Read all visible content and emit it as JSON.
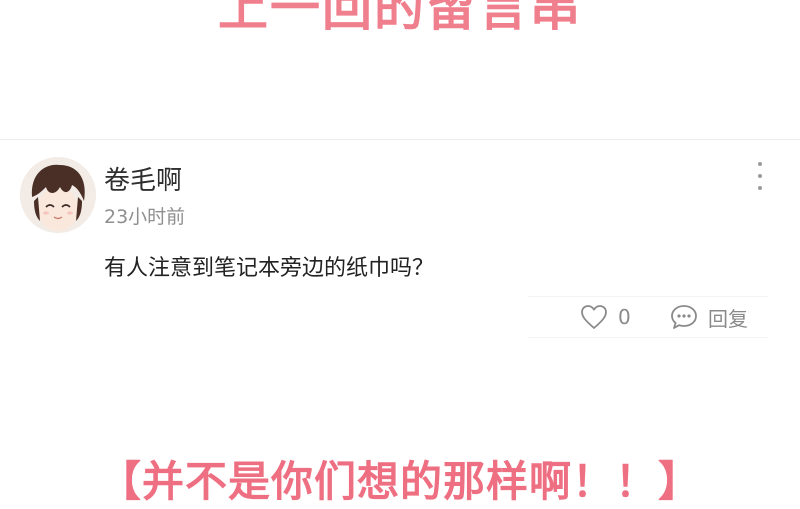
{
  "banner": {
    "text": "上一回的留言串"
  },
  "comment": {
    "username": "卷毛啊",
    "timestamp": "23小时前",
    "text": "有人注意到笔记本旁边的纸巾吗？",
    "likes": "0",
    "reply_label": "回复",
    "icons": {
      "more": "more-vertical-icon",
      "like": "heart-icon",
      "reply": "chat-bubble-icon"
    }
  },
  "caption": {
    "text": "【并不是你们想的那样啊！！】"
  },
  "colors": {
    "accent": "#ef6f82",
    "muted": "#8a8a8a",
    "text": "#222222"
  }
}
